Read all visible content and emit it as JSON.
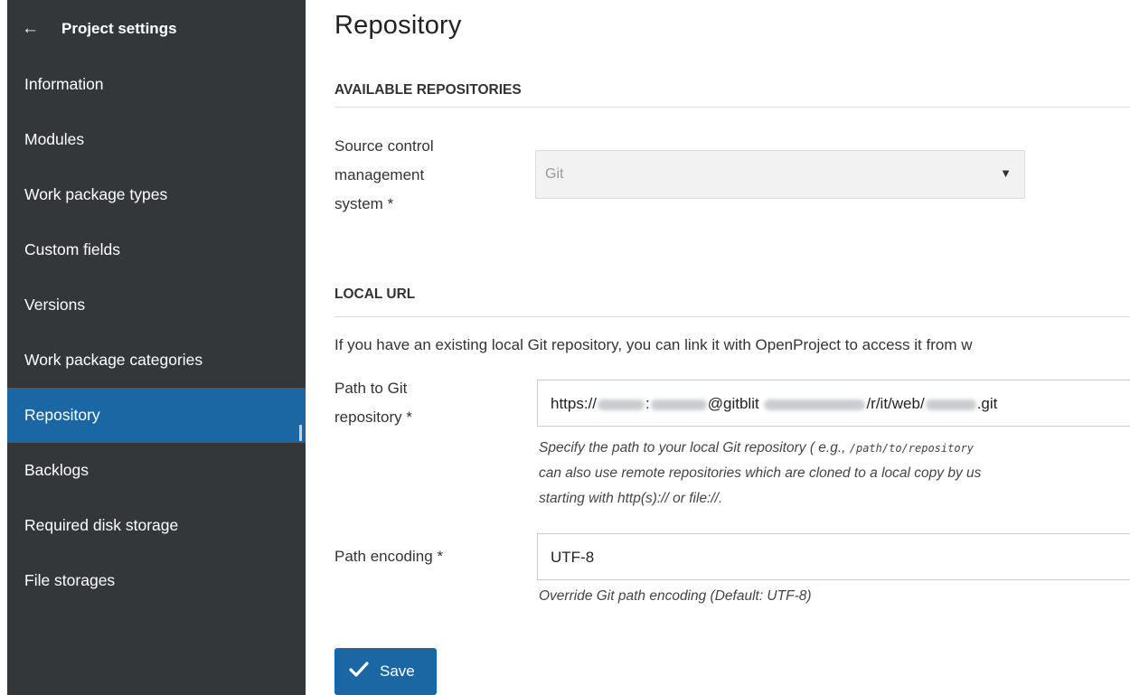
{
  "sidebar": {
    "back_icon": "arrow-left-icon",
    "title": "Project settings",
    "items": [
      {
        "label": "Information"
      },
      {
        "label": "Modules"
      },
      {
        "label": "Work package types"
      },
      {
        "label": "Custom fields"
      },
      {
        "label": "Versions"
      },
      {
        "label": "Work package categories"
      },
      {
        "label": "Repository",
        "active": true
      },
      {
        "label": "Backlogs"
      },
      {
        "label": "Required disk storage"
      },
      {
        "label": "File storages"
      }
    ],
    "colors": {
      "background": "#333739",
      "active": "#1a67a3"
    }
  },
  "page": {
    "title": "Repository"
  },
  "available_repositories": {
    "heading": "AVAILABLE REPOSITORIES",
    "scm_label_1": "Source control",
    "scm_label_2": "management",
    "scm_label_3": "system",
    "required_mark": "*",
    "scm_value": "Git",
    "dropdown_icon": "triangle-down-icon"
  },
  "local_url": {
    "heading": "LOCAL URL",
    "intro": "If you have an existing local Git repository, you can link it with OpenProject to access it from w",
    "path_label_1": "Path to Git",
    "path_label_2": "repository",
    "path_value_prefix": "https://",
    "path_value_host": "@gitblit",
    "path_value_mid": "/r/it/web/",
    "path_value_suffix": ".git",
    "path_hint_line1_a": "Specify the path to your local Git repository ( e.g., ",
    "path_hint_code": "/path/to/repository",
    "path_hint_line2": "can also use remote repositories which are cloned to a local copy by us",
    "path_hint_line3": "starting with http(s):// or file://.",
    "encoding_label": "Path encoding",
    "encoding_value": "UTF-8",
    "encoding_hint": "Override Git path encoding (Default: UTF-8)"
  },
  "actions": {
    "save_label": "Save",
    "save_icon": "checkmark-icon",
    "accent": "#1a67a3"
  }
}
